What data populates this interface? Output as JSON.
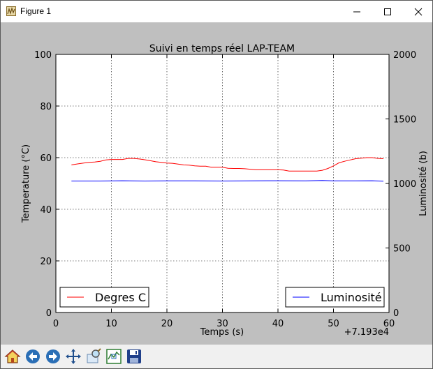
{
  "window": {
    "title": "Figure 1",
    "icon": "matplotlib-icon",
    "controls": [
      "minimize-icon",
      "maximize-icon",
      "close-icon"
    ]
  },
  "toolbar": {
    "buttons": [
      "home-icon",
      "back-arrow-icon",
      "forward-arrow-icon",
      "pan-icon",
      "zoom-icon",
      "subplots-icon",
      "save-icon"
    ]
  },
  "colors": {
    "figure_bg": "#bfbfbf",
    "temperature_line": "#ff0000",
    "luminosity_line": "#0000ff"
  },
  "chart_data": {
    "type": "line",
    "title": "Suivi en temps réel LAP-TEAM",
    "xlabel": "Temps (s)",
    "ylabel": "Temperature (°C)",
    "ylabel_right": "Luminosité (b)",
    "x_offset_label": "+7.193e4",
    "xlim": [
      0,
      60
    ],
    "ylim": [
      0,
      100
    ],
    "ylim_right": [
      0,
      2000
    ],
    "xticks": [
      "0",
      "10",
      "20",
      "30",
      "40",
      "50",
      "60"
    ],
    "yticks": [
      "0",
      "20",
      "40",
      "60",
      "80",
      "100"
    ],
    "yticks_right": [
      "0",
      "500",
      "1000",
      "1500",
      "2000"
    ],
    "grid": true,
    "series": [
      {
        "name": "Degres C",
        "axis": "left",
        "color": "#ff0000",
        "legend_position": "lower-left",
        "x": [
          2.8,
          4,
          5,
          6,
          7,
          8,
          9,
          10,
          11,
          12,
          13,
          14,
          15,
          16,
          17,
          18,
          19,
          20,
          21,
          22,
          23,
          24,
          25,
          26,
          27,
          28,
          29,
          30,
          31,
          32,
          33,
          34,
          35,
          36,
          37,
          38,
          39,
          40,
          41,
          42,
          43,
          44,
          45,
          46,
          47,
          48,
          49,
          50,
          51,
          52,
          53,
          54,
          55,
          56,
          57,
          58,
          59
        ],
        "y": [
          57.2,
          57.6,
          57.9,
          58.2,
          58.3,
          58.6,
          59.1,
          59.3,
          59.3,
          59.3,
          59.7,
          59.7,
          59.5,
          59.2,
          58.8,
          58.4,
          58.2,
          57.9,
          57.8,
          57.5,
          57.2,
          57.1,
          56.8,
          56.7,
          56.7,
          56.3,
          56.3,
          56.3,
          55.9,
          55.8,
          55.8,
          55.7,
          55.5,
          55.3,
          55.3,
          55.3,
          55.3,
          55.3,
          55.2,
          54.8,
          54.8,
          54.8,
          54.8,
          54.8,
          54.8,
          55.1,
          55.8,
          56.8,
          58.0,
          58.6,
          59.1,
          59.6,
          59.8,
          60.0,
          60.0,
          59.7,
          59.6
        ]
      },
      {
        "name": "Luminosité",
        "axis": "right",
        "color": "#0000ff",
        "legend_position": "lower-right",
        "x": [
          2.8,
          8,
          12,
          16,
          20,
          25,
          30,
          35,
          40,
          45,
          48,
          50,
          54,
          57,
          59
        ],
        "y": [
          1019,
          1019,
          1021,
          1019,
          1020,
          1020,
          1019,
          1020,
          1021,
          1020,
          1023,
          1020,
          1020,
          1021,
          1018
        ]
      }
    ]
  }
}
